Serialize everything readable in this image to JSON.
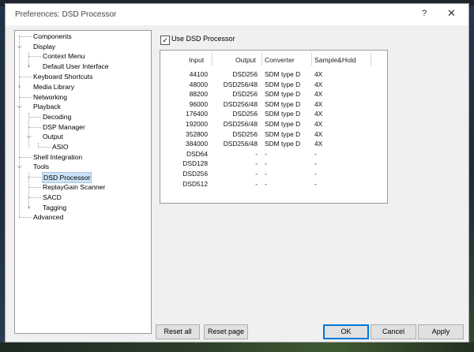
{
  "window": {
    "title": "Preferences: DSD Processor",
    "help_glyph": "?",
    "close_glyph": "✕"
  },
  "tree": [
    {
      "label": "Components",
      "selected": false
    },
    {
      "label": "Display",
      "selected": false
    },
    {
      "label": "Context Menu",
      "selected": false
    },
    {
      "label": "Default User Interface",
      "selected": false
    },
    {
      "label": "Keyboard Shortcuts",
      "selected": false
    },
    {
      "label": "Media Library",
      "selected": false
    },
    {
      "label": "Networking",
      "selected": false
    },
    {
      "label": "Playback",
      "selected": false
    },
    {
      "label": "Decoding",
      "selected": false
    },
    {
      "label": "DSP Manager",
      "selected": false
    },
    {
      "label": "Output",
      "selected": false
    },
    {
      "label": "ASIO",
      "selected": false
    },
    {
      "label": "Shell Integration",
      "selected": false
    },
    {
      "label": "Tools",
      "selected": false
    },
    {
      "label": "DSD Processor",
      "selected": true
    },
    {
      "label": "ReplayGain Scanner",
      "selected": false
    },
    {
      "label": "SACD",
      "selected": false
    },
    {
      "label": "Tagging",
      "selected": false
    },
    {
      "label": "Advanced",
      "selected": false
    }
  ],
  "use_dsd": {
    "label": "Use DSD Processor",
    "checked": true,
    "check_glyph": "✓"
  },
  "table": {
    "headers": [
      "Input",
      "Output",
      "Converter",
      "Sample&Hold"
    ],
    "rows": [
      [
        "44100",
        "DSD256",
        "SDM type D",
        "4X"
      ],
      [
        "48000",
        "DSD256/48",
        "SDM type D",
        "4X"
      ],
      [
        "88200",
        "DSD256",
        "SDM type D",
        "4X"
      ],
      [
        "96000",
        "DSD256/48",
        "SDM type D",
        "4X"
      ],
      [
        "176400",
        "DSD256",
        "SDM type D",
        "4X"
      ],
      [
        "192000",
        "DSD256/48",
        "SDM type D",
        "4X"
      ],
      [
        "352800",
        "DSD256",
        "SDM type D",
        "4X"
      ],
      [
        "384000",
        "DSD256/48",
        "SDM type D",
        "4X"
      ],
      [
        "DSD64",
        "-",
        "-",
        "-"
      ],
      [
        "DSD128",
        "-",
        "-",
        "-"
      ],
      [
        "DSD256",
        "-",
        "-",
        "-"
      ],
      [
        "DSD512",
        "-",
        "-",
        "-"
      ]
    ]
  },
  "buttons": {
    "reset_all": "Reset all",
    "reset_page": "Reset page",
    "ok": "OK",
    "cancel": "Cancel",
    "apply": "Apply"
  }
}
